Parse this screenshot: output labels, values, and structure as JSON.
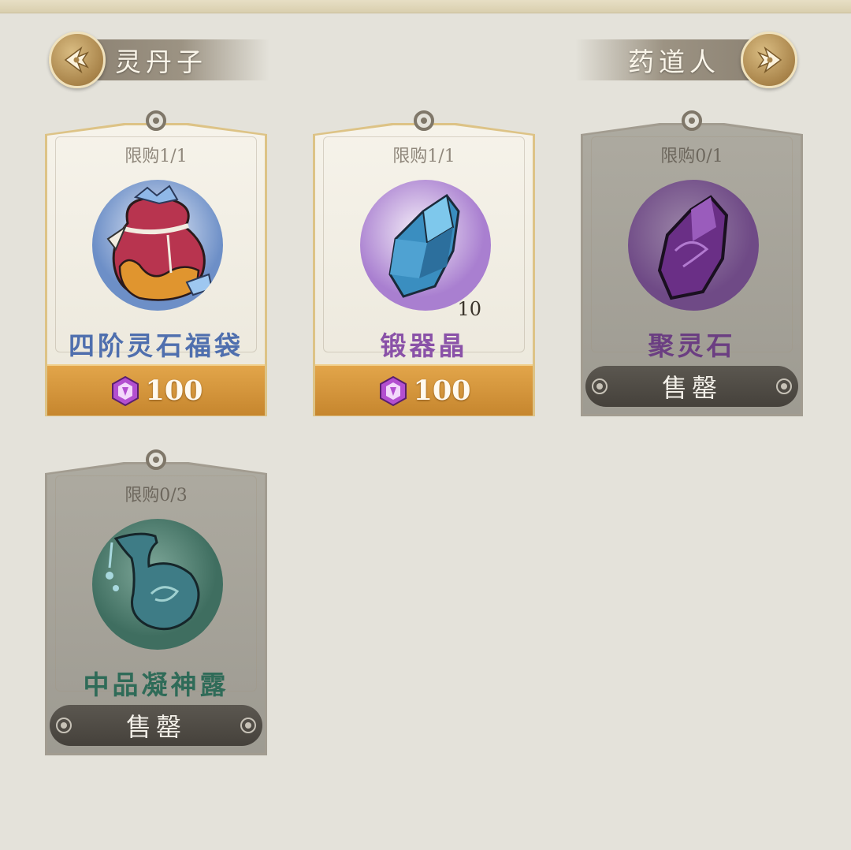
{
  "header": {
    "left_nav": {
      "label": "灵丹子"
    },
    "right_nav": {
      "label": "药道人"
    }
  },
  "shop_items": [
    {
      "limit": "限购1/1",
      "name": "四阶灵石福袋",
      "name_color": "#4f6fae",
      "price": "100",
      "status": "available",
      "icon": "lucky-bag-icon"
    },
    {
      "limit": "限购1/1",
      "name": "锻器晶",
      "name_color": "#8a52a8",
      "price": "100",
      "quantity": "10",
      "status": "available",
      "icon": "blue-crystal-icon"
    },
    {
      "limit": "限购0/1",
      "name": "聚灵石",
      "name_color": "#6b3e82",
      "sold_label": "售罄",
      "status": "sold-out",
      "icon": "purple-stone-icon"
    },
    {
      "limit": "限购0/3",
      "name": "中品凝神露",
      "name_color": "#2f6b58",
      "sold_label": "售罄",
      "status": "sold-out",
      "icon": "potion-flask-icon"
    }
  ],
  "colors": {
    "background": "#e4e2da",
    "price_bar": "#d39a40",
    "sold_bar": "#4f4b45",
    "currency_gem": "#b34fd0"
  }
}
